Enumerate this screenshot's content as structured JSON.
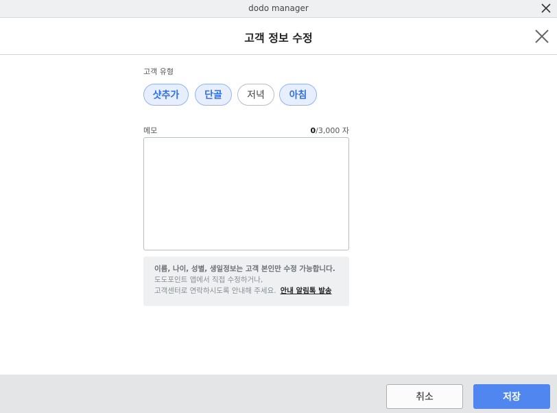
{
  "window": {
    "title": "dodo manager"
  },
  "header": {
    "title": "고객 정보 수정"
  },
  "customer_type": {
    "label": "고객 유형",
    "chips": [
      {
        "label": "샷추가",
        "selected": true
      },
      {
        "label": "단골",
        "selected": true
      },
      {
        "label": "저녁",
        "selected": false
      },
      {
        "label": "아침",
        "selected": true
      }
    ]
  },
  "memo": {
    "label": "메모",
    "count": "0",
    "limit": "/3,000 자",
    "value": ""
  },
  "notice": {
    "line1": "이름, 나이, 성별, 생일정보는 고객 본인만 수정 가능합니다.",
    "line2": "도도포인트 앱에서 직접 수정하거나,",
    "line3": "고객센터로 연락하시도록 안내해 주세요.",
    "link": "안내 알림톡 발송"
  },
  "footer": {
    "cancel": "취소",
    "save": "저장"
  },
  "colors": {
    "accent": "#4f86ef",
    "chip_selected_bg": "#e7efff",
    "footer_bg": "#e4e5e7"
  },
  "icons": {
    "window_close": "close-icon",
    "dialog_close": "close-icon"
  }
}
